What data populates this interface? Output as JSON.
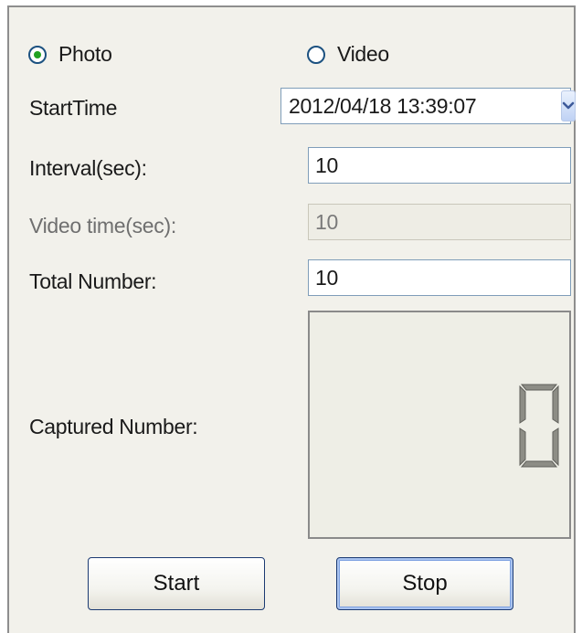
{
  "mode": {
    "options": [
      {
        "label": "Photo",
        "selected": true
      },
      {
        "label": "Video",
        "selected": false
      }
    ]
  },
  "fields": {
    "start_time": {
      "label": "StartTime",
      "value": "2012/04/18 13:39:07"
    },
    "interval": {
      "label": "Interval(sec):",
      "value": "10"
    },
    "video_time": {
      "label": "Video time(sec):",
      "value": "10",
      "disabled": true
    },
    "total_number": {
      "label": "Total Number:",
      "value": "10"
    }
  },
  "captured": {
    "label": "Captured Number:",
    "value": 0
  },
  "buttons": {
    "start_label": "Start",
    "stop_label": "Stop"
  },
  "colors": {
    "panel_bg": "#f2f1eb",
    "radio_selected_dot": "#21a121",
    "lcd_segment": "#8d8d86",
    "button_border": "#1b3a72"
  },
  "icons": {
    "spin": "up-down-arrows-icon",
    "dropdown": "chevron-down-icon",
    "radio": "radio-icon"
  }
}
